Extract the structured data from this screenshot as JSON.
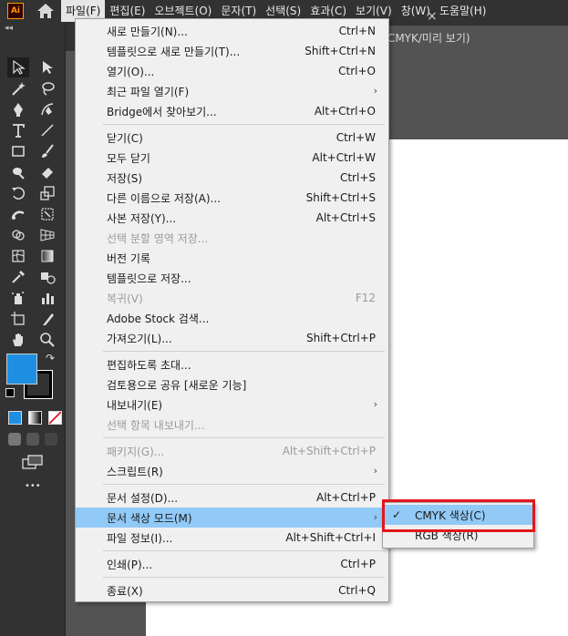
{
  "app": {
    "logo_text": "Ai",
    "brand_color": "#ff9a00"
  },
  "menubar": {
    "items": [
      "파일(F)",
      "편집(E)",
      "오브젝트(O)",
      "문자(T)",
      "선택(S)",
      "효과(C)",
      "보기(V)",
      "창(W)",
      "도움말(H)"
    ],
    "active_index": 0
  },
  "toolbar": {
    "collapse_glyph": "◂◂",
    "fill_color": "#1e8fe3",
    "more_glyph": "•••"
  },
  "document": {
    "tab_title": "s(CMYK/미리 보기)",
    "close_glyph": "×"
  },
  "file_menu": {
    "items": [
      {
        "label": "새로 만들기(N)...",
        "shortcut": "Ctrl+N"
      },
      {
        "label": "템플릿으로 새로 만들기(T)...",
        "shortcut": "Shift+Ctrl+N"
      },
      {
        "label": "열기(O)...",
        "shortcut": "Ctrl+O"
      },
      {
        "label": "최근 파일 열기(F)",
        "shortcut": ""
      },
      {
        "label": "Bridge에서 찾아보기...",
        "shortcut": "Alt+Ctrl+O"
      },
      {
        "label": "닫기(C)",
        "shortcut": "Ctrl+W"
      },
      {
        "label": "모두 닫기",
        "shortcut": "Alt+Ctrl+W"
      },
      {
        "label": "저장(S)",
        "shortcut": "Ctrl+S"
      },
      {
        "label": "다른 이름으로 저장(A)...",
        "shortcut": "Shift+Ctrl+S"
      },
      {
        "label": "사본 저장(Y)...",
        "shortcut": "Alt+Ctrl+S"
      },
      {
        "label": "선택 분할 영역 저장...",
        "shortcut": ""
      },
      {
        "label": "버전 기록",
        "shortcut": ""
      },
      {
        "label": "템플릿으로 저장...",
        "shortcut": ""
      },
      {
        "label": "복귀(V)",
        "shortcut": "F12"
      },
      {
        "label": "Adobe Stock 검색...",
        "shortcut": ""
      },
      {
        "label": "가져오기(L)...",
        "shortcut": "Shift+Ctrl+P"
      },
      {
        "label": "편집하도록 초대...",
        "shortcut": ""
      },
      {
        "label": "검토용으로 공유 [새로운 기능]",
        "shortcut": ""
      },
      {
        "label": "내보내기(E)",
        "shortcut": ""
      },
      {
        "label": "선택 항목 내보내기...",
        "shortcut": ""
      },
      {
        "label": "패키지(G)...",
        "shortcut": "Alt+Shift+Ctrl+P"
      },
      {
        "label": "스크립트(R)",
        "shortcut": ""
      },
      {
        "label": "문서 설정(D)...",
        "shortcut": "Alt+Ctrl+P"
      },
      {
        "label": "문서 색상 모드(M)",
        "shortcut": ""
      },
      {
        "label": "파일 정보(I)...",
        "shortcut": "Alt+Shift+Ctrl+I"
      },
      {
        "label": "인쇄(P)...",
        "shortcut": "Ctrl+P"
      },
      {
        "label": "종료(X)",
        "shortcut": "Ctrl+Q"
      }
    ],
    "submenu_arrow": "›"
  },
  "color_mode_submenu": {
    "check_glyph": "✓",
    "items": [
      {
        "label": "CMYK 색상(C)",
        "checked": true
      },
      {
        "label": "RGB 색상(R)",
        "checked": false
      }
    ]
  },
  "colors": {
    "highlight": "#91c9f7",
    "callout_border": "#e3161c"
  }
}
